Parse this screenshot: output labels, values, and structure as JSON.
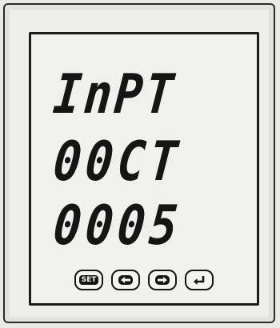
{
  "display": {
    "line1": "InPT",
    "line2": "00CT",
    "line3": "0005"
  },
  "keys": [
    {
      "label": "SET",
      "icon": "set-icon"
    },
    {
      "label": "",
      "icon": "left-arrow-icon"
    },
    {
      "label": "",
      "icon": "right-arrow-icon"
    },
    {
      "label": "",
      "icon": "enter-icon"
    }
  ]
}
